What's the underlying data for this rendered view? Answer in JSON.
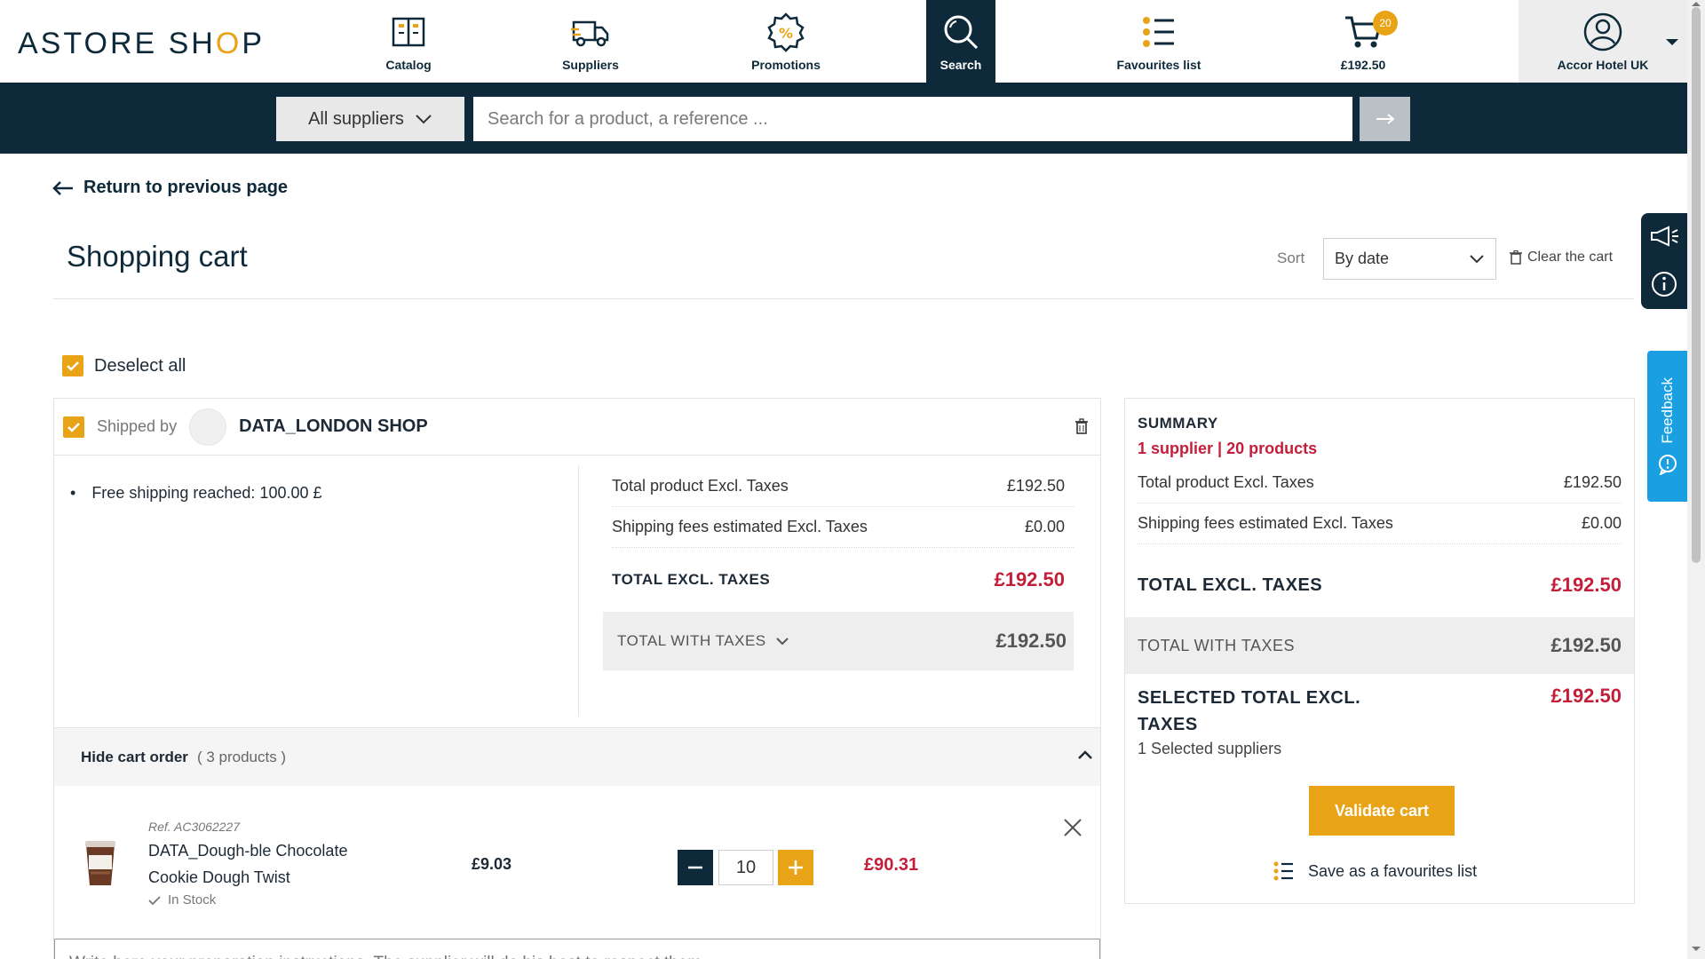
{
  "header": {
    "logo_text_a": "ASTORE SH",
    "logo_text_b": "O",
    "logo_text_c": "P",
    "nav": {
      "catalog": "Catalog",
      "suppliers": "Suppliers",
      "promotions": "Promotions",
      "search": "Search",
      "favourites": "Favourites list",
      "cart_amount": "£192.50",
      "cart_count": "20",
      "account": "Accor Hotel UK"
    }
  },
  "search": {
    "supplier_filter": "All suppliers",
    "placeholder": "Search for a product, a reference ..."
  },
  "page": {
    "return_label": "Return to previous page",
    "title": "Shopping cart",
    "sort_label": "Sort",
    "sort_value": "By date",
    "clear_label": "Clear the cart",
    "deselect_label": "Deselect all",
    "feedback_label": "Feedback"
  },
  "supplier": {
    "shipped_by": "Shipped by",
    "name": "DATA_LONDON SHOP",
    "free_shipping": "Free shipping reached: 100.00 £",
    "total_product_label": "Total product Excl. Taxes",
    "total_product_value": "£192.50",
    "shipping_label": "Shipping fees estimated Excl. Taxes",
    "shipping_value": "£0.00",
    "total_excl_label": "TOTAL EXCL. TAXES",
    "total_excl_value": "£192.50",
    "total_with_label": "TOTAL WITH TAXES",
    "total_with_value": "£192.50",
    "hide_order_label": "Hide cart order",
    "hide_order_count": "( 3 products )"
  },
  "product": {
    "ref": "Ref. AC3062227",
    "name": "DATA_Dough-ble Chocolate Cookie Dough Twist",
    "stock": "In Stock",
    "unit_price": "£9.03",
    "quantity": "10",
    "total": "£90.31"
  },
  "notes_placeholder": "Write here your preparation instructions. The supplier will do his best to respect them.",
  "summary": {
    "title": "SUMMARY",
    "subtitle": "1 supplier | 20 products",
    "total_product_label": "Total product Excl. Taxes",
    "total_product_value": "£192.50",
    "shipping_label": "Shipping fees estimated Excl. Taxes",
    "shipping_value": "£0.00",
    "total_excl_label": "TOTAL EXCL. TAXES",
    "total_excl_value": "£192.50",
    "total_with_label": "TOTAL WITH TAXES",
    "total_with_value": "£192.50",
    "selected_label": "SELECTED TOTAL EXCL. TAXES",
    "selected_value": "£192.50",
    "selected_sub": "1 Selected suppliers",
    "validate_label": "Validate cart",
    "save_fav_label": "Save as a favourites list"
  },
  "colors": {
    "navy": "#0e2a3a",
    "accent": "#e8a416",
    "price": "#c41f3a",
    "feedback": "#1a9fe3"
  }
}
